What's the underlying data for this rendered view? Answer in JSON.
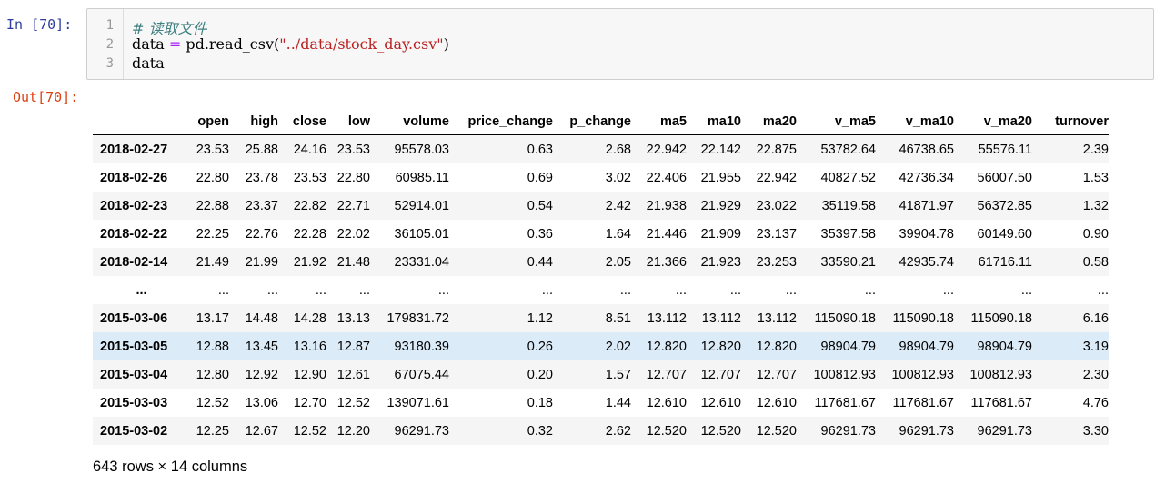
{
  "cell": {
    "in_prompt": "In  [70]:",
    "out_prompt": "Out[70]:",
    "line_numbers": [
      "1",
      "2",
      "3"
    ],
    "code": {
      "line1_comment": "# 读取文件",
      "line2_var": "data ",
      "line2_op": "=",
      "line2_call": " pd.read_csv(",
      "line2_str": "\"../data/stock_day.csv\"",
      "line2_close": ")",
      "line3": "data"
    }
  },
  "dataframe": {
    "columns": [
      "open",
      "high",
      "close",
      "low",
      "volume",
      "price_change",
      "p_change",
      "ma5",
      "ma10",
      "ma20",
      "v_ma5",
      "v_ma10",
      "v_ma20",
      "turnover"
    ],
    "rows": [
      {
        "index": "2018-02-27",
        "values": [
          "23.53",
          "25.88",
          "24.16",
          "23.53",
          "95578.03",
          "0.63",
          "2.68",
          "22.942",
          "22.142",
          "22.875",
          "53782.64",
          "46738.65",
          "55576.11",
          "2.39"
        ]
      },
      {
        "index": "2018-02-26",
        "values": [
          "22.80",
          "23.78",
          "23.53",
          "22.80",
          "60985.11",
          "0.69",
          "3.02",
          "22.406",
          "21.955",
          "22.942",
          "40827.52",
          "42736.34",
          "56007.50",
          "1.53"
        ]
      },
      {
        "index": "2018-02-23",
        "values": [
          "22.88",
          "23.37",
          "22.82",
          "22.71",
          "52914.01",
          "0.54",
          "2.42",
          "21.938",
          "21.929",
          "23.022",
          "35119.58",
          "41871.97",
          "56372.85",
          "1.32"
        ]
      },
      {
        "index": "2018-02-22",
        "values": [
          "22.25",
          "22.76",
          "22.28",
          "22.02",
          "36105.01",
          "0.36",
          "1.64",
          "21.446",
          "21.909",
          "23.137",
          "35397.58",
          "39904.78",
          "60149.60",
          "0.90"
        ]
      },
      {
        "index": "2018-02-14",
        "values": [
          "21.49",
          "21.99",
          "21.92",
          "21.48",
          "23331.04",
          "0.44",
          "2.05",
          "21.366",
          "21.923",
          "23.253",
          "33590.21",
          "42935.74",
          "61716.11",
          "0.58"
        ]
      },
      {
        "index": "...",
        "values": [
          "...",
          "...",
          "...",
          "...",
          "...",
          "...",
          "...",
          "...",
          "...",
          "...",
          "...",
          "...",
          "...",
          "..."
        ],
        "ellipsis": true
      },
      {
        "index": "2015-03-06",
        "values": [
          "13.17",
          "14.48",
          "14.28",
          "13.13",
          "179831.72",
          "1.12",
          "8.51",
          "13.112",
          "13.112",
          "13.112",
          "115090.18",
          "115090.18",
          "115090.18",
          "6.16"
        ]
      },
      {
        "index": "2015-03-05",
        "values": [
          "12.88",
          "13.45",
          "13.16",
          "12.87",
          "93180.39",
          "0.26",
          "2.02",
          "12.820",
          "12.820",
          "12.820",
          "98904.79",
          "98904.79",
          "98904.79",
          "3.19"
        ],
        "highlight": true
      },
      {
        "index": "2015-03-04",
        "values": [
          "12.80",
          "12.92",
          "12.90",
          "12.61",
          "67075.44",
          "0.20",
          "1.57",
          "12.707",
          "12.707",
          "12.707",
          "100812.93",
          "100812.93",
          "100812.93",
          "2.30"
        ]
      },
      {
        "index": "2015-03-03",
        "values": [
          "12.52",
          "13.06",
          "12.70",
          "12.52",
          "139071.61",
          "0.18",
          "1.44",
          "12.610",
          "12.610",
          "12.610",
          "117681.67",
          "117681.67",
          "117681.67",
          "4.76"
        ]
      },
      {
        "index": "2015-03-02",
        "values": [
          "12.25",
          "12.67",
          "12.52",
          "12.20",
          "96291.73",
          "0.32",
          "2.62",
          "12.520",
          "12.520",
          "12.520",
          "96291.73",
          "96291.73",
          "96291.73",
          "3.30"
        ]
      }
    ],
    "shape_text": "643 rows × 14 columns"
  },
  "colors": {
    "in_prompt": "#303f9f",
    "out_prompt": "#d84315",
    "comment": "#408080",
    "string": "#ba2121",
    "operator": "#aa22ff",
    "row_stripe": "#f5f5f5",
    "row_highlight": "#dcebf8"
  }
}
